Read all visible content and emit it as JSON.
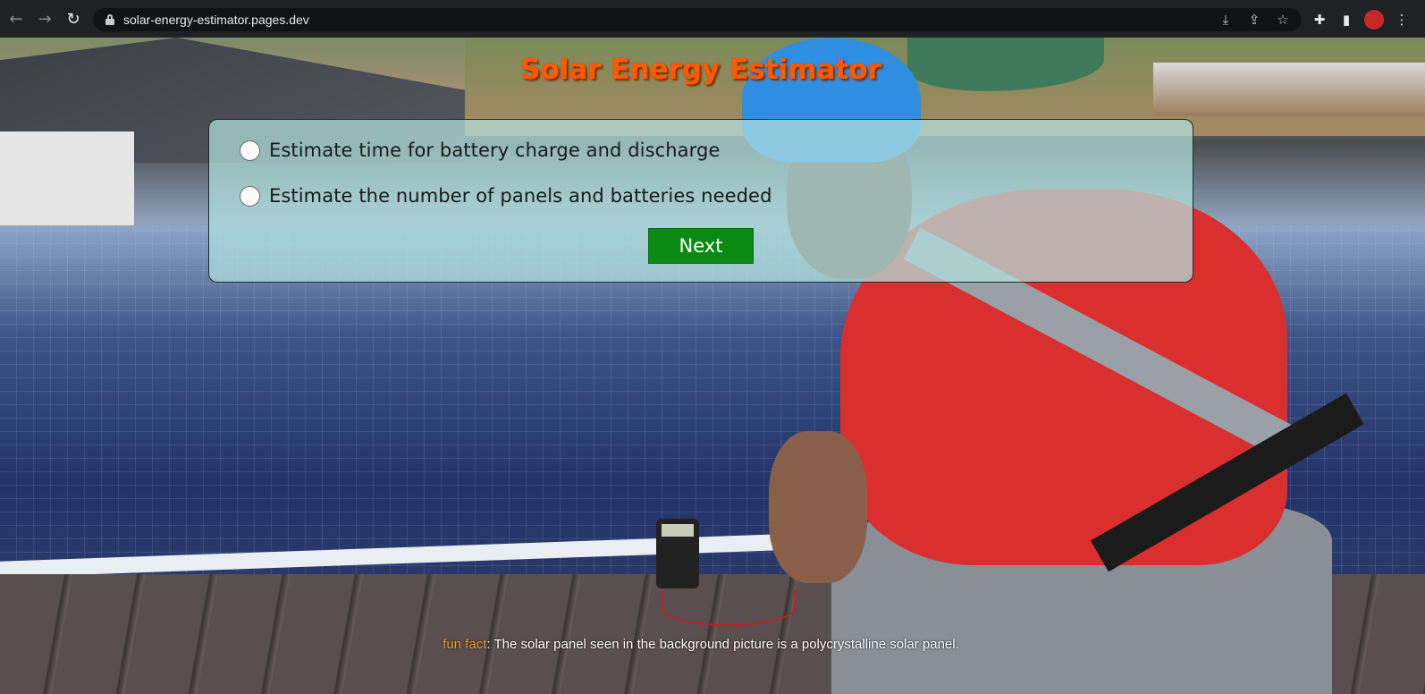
{
  "browser": {
    "url": "solar-energy-estimator.pages.dev",
    "back_icon": "arrow-left-icon",
    "forward_icon": "arrow-right-icon",
    "reload_icon": "reload-icon"
  },
  "page": {
    "title": "Solar Energy Estimator",
    "options": [
      {
        "label": "Estimate time for battery charge and discharge",
        "checked": false
      },
      {
        "label": "Estimate the number of panels and batteries needed",
        "checked": false
      }
    ],
    "next_label": "Next",
    "footer": {
      "prefix": "fun fact",
      "text": ": The solar panel seen in the background picture is a polycrystalline solar panel."
    }
  },
  "colors": {
    "title": "#ff5a00",
    "next_button": "#0a8a12",
    "fun_fact": "#f0a020",
    "card": "#b2e2de"
  }
}
